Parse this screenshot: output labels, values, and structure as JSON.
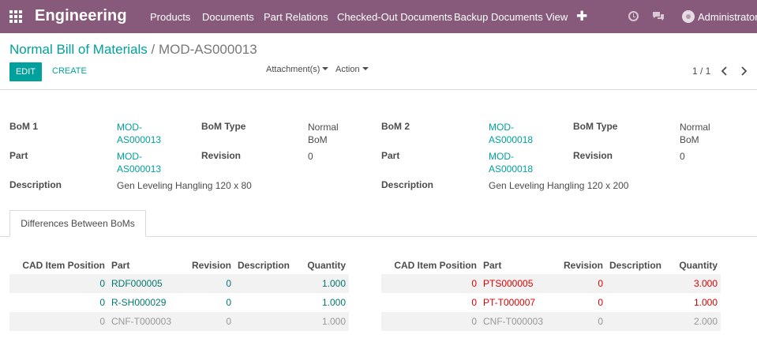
{
  "app": {
    "title": "Engineering"
  },
  "nav": {
    "menu": [
      "Products",
      "Documents",
      "Part Relations",
      "Checked-Out Documents",
      "Backup Documents View"
    ],
    "plus": "✚",
    "user": "Administrator"
  },
  "breadcrumb": {
    "parent": "Normal Bill of Materials",
    "separator": "/",
    "current": "MOD-AS000013"
  },
  "toolbar": {
    "edit": "EDIT",
    "create": "CREATE",
    "attachments": "Attachment(s)",
    "action": "Action"
  },
  "pager": {
    "text": "1 / 1"
  },
  "bom1": {
    "label_bom": "BoM 1",
    "bom_line1": "MOD-",
    "bom_line2": "AS000013",
    "label_type": "BoM Type",
    "type_line1": "Normal",
    "type_line2": "BoM",
    "label_part": "Part",
    "part_line1": "MOD-",
    "part_line2": "AS000013",
    "label_revision": "Revision",
    "revision": "0",
    "label_description": "Description",
    "description": "Gen Leveling Hangling 120 x 80"
  },
  "bom2": {
    "label_bom": "BoM 2",
    "bom_line1": "MOD-",
    "bom_line2": "AS000018",
    "label_type": "BoM Type",
    "type_line1": "Normal",
    "type_line2": "BoM",
    "label_part": "Part",
    "part_line1": "MOD-",
    "part_line2": "AS000018",
    "label_revision": "Revision",
    "revision": "0",
    "label_description": "Description",
    "description": "Gen Leveling Hangling 120 x 200"
  },
  "tab": {
    "label": "Differences Between BoMs"
  },
  "table_headers": [
    "CAD Item Position",
    "Part",
    "Revision",
    "Description",
    "Quantity"
  ],
  "table1": [
    {
      "pos": "0",
      "part": "RDF000005",
      "rev": "0",
      "desc": "",
      "qty": "1.000"
    },
    {
      "pos": "0",
      "part": "R-SH000029",
      "rev": "0",
      "desc": "",
      "qty": "1.000"
    },
    {
      "pos": "0",
      "part": "CNF-T000003",
      "rev": "0",
      "desc": "",
      "qty": "1.000"
    }
  ],
  "table2": [
    {
      "pos": "0",
      "part": "PTS000005",
      "rev": "0",
      "desc": "",
      "qty": "3.000"
    },
    {
      "pos": "0",
      "part": "PT-T000007",
      "rev": "0",
      "desc": "",
      "qty": "1.000"
    },
    {
      "pos": "0",
      "part": "CNF-T000003",
      "rev": "0",
      "desc": "",
      "qty": "2.000"
    }
  ],
  "colors": {
    "navbar": "#875a7b",
    "accent": "#00a09d",
    "added": "#00786f",
    "removed": "#dc0000",
    "unchanged": "#999999"
  }
}
